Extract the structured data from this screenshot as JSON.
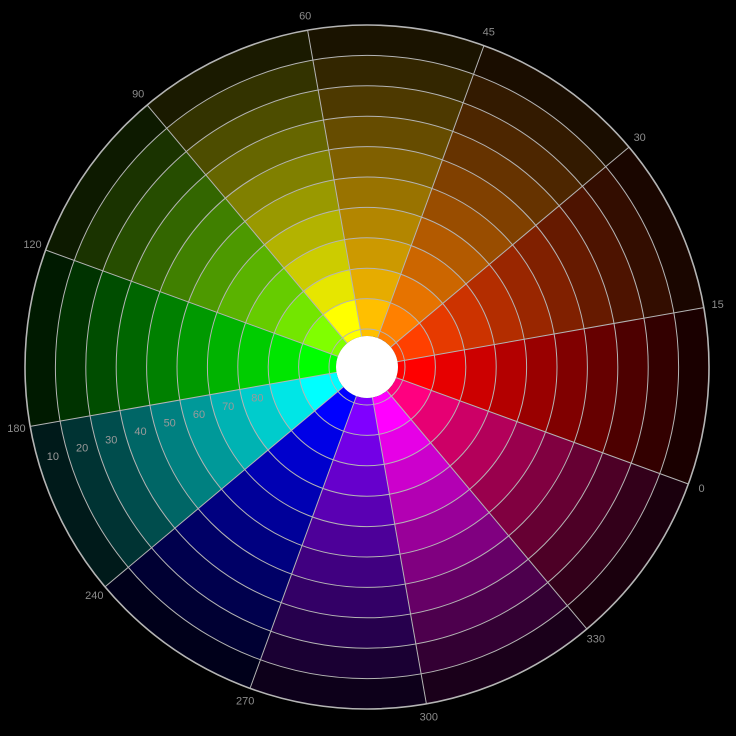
{
  "wheel": {
    "background": "#000000",
    "line_color": "#b4b4b4",
    "center_color": "#ffffff",
    "segments": [
      {
        "hue_label": "0",
        "color": "#ff0000"
      },
      {
        "hue_label": "15",
        "color": "#ff4000"
      },
      {
        "hue_label": "30",
        "color": "#ff8000"
      },
      {
        "hue_label": "45",
        "color": "#ffbf00"
      },
      {
        "hue_label": "60",
        "color": "#ffff00"
      },
      {
        "hue_label": "90",
        "color": "#80ff00"
      },
      {
        "hue_label": "120",
        "color": "#00ff00"
      },
      {
        "hue_label": "180",
        "color": "#00ffff"
      },
      {
        "hue_label": "240",
        "color": "#0000ff"
      },
      {
        "hue_label": "270",
        "color": "#8000ff"
      },
      {
        "hue_label": "300",
        "color": "#ff00ff"
      },
      {
        "hue_label": "330",
        "color": "#ff0080"
      }
    ],
    "rings": [
      {
        "label": "10",
        "brightness": 0.1
      },
      {
        "label": "20",
        "brightness": 0.2
      },
      {
        "label": "30",
        "brightness": 0.3
      },
      {
        "label": "40",
        "brightness": 0.4
      },
      {
        "label": "50",
        "brightness": 0.5
      },
      {
        "label": "60",
        "brightness": 0.6
      },
      {
        "label": "70",
        "brightness": 0.7
      },
      {
        "label": "80",
        "brightness": 0.8
      },
      {
        "label": "",
        "brightness": 0.9
      },
      {
        "label": "",
        "brightness": 1.0
      }
    ]
  }
}
